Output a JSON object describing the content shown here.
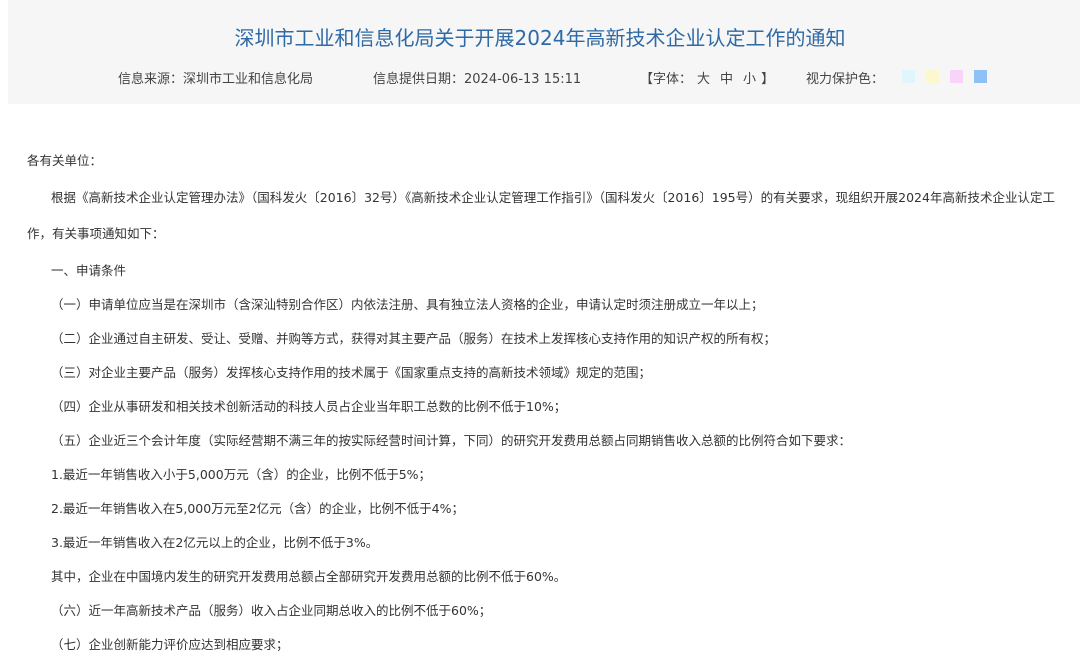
{
  "header": {
    "title": "深圳市工业和信息化局关于开展2024年高新技术企业认定工作的通知",
    "source": "信息来源：深圳市工业和信息化局",
    "date": "信息提供日期：2024-06-13 15:11",
    "font_prefix": "【字体：",
    "font_large": "大",
    "font_medium": "中",
    "font_small": "小",
    "font_suffix": "】",
    "eye_label": "视力保护色：",
    "swatches": [
      "#e1f5fc",
      "#fbf8cf",
      "#f9d3fa",
      "#8ec2f6"
    ]
  },
  "body": {
    "salutation": "各有关单位：",
    "intro": "根据《高新技术企业认定管理办法》（国科发火〔2016〕32号）《高新技术企业认定管理工作指引》（国科发火〔2016〕195号）的有关要求，现组织开展2024年高新技术企业认定工作，有关事项通知如下：",
    "section1": "一、申请条件",
    "items": [
      "（一）申请单位应当是在深圳市（含深汕特别合作区）内依法注册、具有独立法人资格的企业，申请认定时须注册成立一年以上；",
      "（二）企业通过自主研发、受让、受赠、并购等方式，获得对其主要产品（服务）在技术上发挥核心支持作用的知识产权的所有权；",
      "（三）对企业主要产品（服务）发挥核心支持作用的技术属于《国家重点支持的高新技术领域》规定的范围；",
      "（四）企业从事研发和相关技术创新活动的科技人员占企业当年职工总数的比例不低于10%；",
      "（五）企业近三个会计年度（实际经营期不满三年的按实际经营时间计算，下同）的研究开发费用总额占同期销售收入总额的比例符合如下要求："
    ],
    "subitems": [
      "1.最近一年销售收入小于5,000万元（含）的企业，比例不低于5%；",
      "2.最近一年销售收入在5,000万元至2亿元（含）的企业，比例不低于4%；",
      "3.最近一年销售收入在2亿元以上的企业，比例不低于3%。"
    ],
    "note": "其中，企业在中国境内发生的研究开发费用总额占全部研究开发费用总额的比例不低于60%。",
    "items2": [
      "（六）近一年高新技术产品（服务）收入占企业同期总收入的比例不低于60%；",
      "（七）企业创新能力评价应达到相应要求；"
    ]
  }
}
